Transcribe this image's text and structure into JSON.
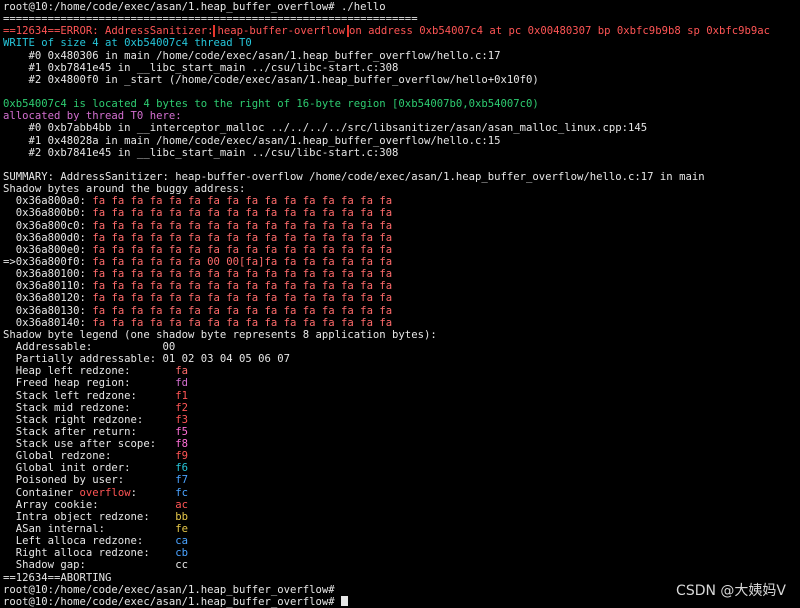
{
  "term": {
    "cmd": "root@10:/home/code/exec/asan/1.heap_buffer_overflow# ./hello",
    "sep": "=================================================================",
    "err_prefix": "==12634==ERROR: AddressSanitizer:",
    "err_kind": "heap-buffer-overflow",
    "err_rest": "on address 0xb54007c4 at pc 0x00480307 bp 0xbfc9b9b8 sp 0xbfc9b9ac",
    "write": "WRITE of size 4 at 0xb54007c4 thread T0",
    "f0": "    #0 0x480306 in main /home/code/exec/asan/1.heap_buffer_overflow/hello.c:17",
    "f1": "    #1 0xb7841e45 in __libc_start_main ../csu/libc-start.c:308",
    "f2": "    #2 0x4800f0 in _start (/home/code/exec/asan/1.heap_buffer_overflow/hello+0x10f0)",
    "located": "0xb54007c4 is located 4 bytes to the right of 16-byte region [0xb54007b0,0xb54007c0)",
    "alloc": "allocated by thread T0 here:",
    "a0": "    #0 0xb7abb4bb in __interceptor_malloc ../../../../src/libsanitizer/asan/asan_malloc_linux.cpp:145",
    "a1": "    #1 0x48028a in main /home/code/exec/asan/1.heap_buffer_overflow/hello.c:15",
    "a2": "    #2 0xb7841e45 in __libc_start_main ../csu/libc-start.c:308",
    "summary": "SUMMARY: AddressSanitizer: heap-buffer-overflow /home/code/exec/asan/1.heap_buffer_overflow/hello.c:17 in main",
    "shadow_hdr": "Shadow bytes around the buggy address:",
    "sh": [
      {
        "addr": "  0x36a800a0:",
        "bytes": "fa fa fa fa fa fa fa fa fa fa fa fa fa fa fa fa"
      },
      {
        "addr": "  0x36a800b0:",
        "bytes": "fa fa fa fa fa fa fa fa fa fa fa fa fa fa fa fa"
      },
      {
        "addr": "  0x36a800c0:",
        "bytes": "fa fa fa fa fa fa fa fa fa fa fa fa fa fa fa fa"
      },
      {
        "addr": "  0x36a800d0:",
        "bytes": "fa fa fa fa fa fa fa fa fa fa fa fa fa fa fa fa"
      },
      {
        "addr": "  0x36a800e0:",
        "bytes": "fa fa fa fa fa fa fa fa fa fa fa fa fa fa fa fa"
      },
      {
        "addr": "=>0x36a800f0:",
        "bytes": "fa fa fa fa fa fa 00 00[fa]fa fa fa fa fa fa fa"
      },
      {
        "addr": "  0x36a80100:",
        "bytes": "fa fa fa fa fa fa fa fa fa fa fa fa fa fa fa fa"
      },
      {
        "addr": "  0x36a80110:",
        "bytes": "fa fa fa fa fa fa fa fa fa fa fa fa fa fa fa fa"
      },
      {
        "addr": "  0x36a80120:",
        "bytes": "fa fa fa fa fa fa fa fa fa fa fa fa fa fa fa fa"
      },
      {
        "addr": "  0x36a80130:",
        "bytes": "fa fa fa fa fa fa fa fa fa fa fa fa fa fa fa fa"
      },
      {
        "addr": "  0x36a80140:",
        "bytes": "fa fa fa fa fa fa fa fa fa fa fa fa fa fa fa fa"
      }
    ],
    "legend_hdr": "Shadow byte legend (one shadow byte represents 8 application bytes):",
    "legend": [
      {
        "label": "  Addressable:           ",
        "val": "00",
        "cls": "w"
      },
      {
        "label": "  Partially addressable: ",
        "val": "01 02 03 04 05 06 07",
        "cls": "w"
      },
      {
        "label": "  Heap left redzone:       ",
        "val": "fa",
        "cls": "fa"
      },
      {
        "label": "  Freed heap region:       ",
        "val": "fd",
        "cls": "m"
      },
      {
        "label": "  Stack left redzone:      ",
        "val": "f1",
        "cls": "r"
      },
      {
        "label": "  Stack mid redzone:       ",
        "val": "f2",
        "cls": "r"
      },
      {
        "label": "  Stack right redzone:     ",
        "val": "f3",
        "cls": "r"
      },
      {
        "label": "  Stack after return:      ",
        "val": "f5",
        "cls": "p"
      },
      {
        "label": "  Stack use after scope:   ",
        "val": "f8",
        "cls": "p"
      },
      {
        "label": "  Global redzone:          ",
        "val": "f9",
        "cls": "r"
      },
      {
        "label": "  Global init order:       ",
        "val": "f6",
        "cls": "c"
      },
      {
        "label": "  Poisoned by user:        ",
        "val": "f7",
        "cls": "b"
      },
      {
        "label": "  Container ",
        "mid": "overflow",
        "label2": ":      ",
        "val": "fc",
        "cls": "b"
      },
      {
        "label": "  Array cookie:            ",
        "val": "ac",
        "cls": "r"
      },
      {
        "label": "  Intra object redzone:    ",
        "val": "bb",
        "cls": "y"
      },
      {
        "label": "  ASan internal:           ",
        "val": "fe",
        "cls": "y"
      },
      {
        "label": "  Left alloca redzone:     ",
        "val": "ca",
        "cls": "b"
      },
      {
        "label": "  Right alloca redzone:    ",
        "val": "cb",
        "cls": "b"
      },
      {
        "label": "  Shadow gap:              ",
        "val": "cc",
        "cls": "w"
      }
    ],
    "abort": "==12634==ABORTING",
    "prompt2": "root@10:/home/code/exec/asan/1.heap_buffer_overflow#",
    "prompt3": "root@10:/home/code/exec/asan/1.heap_buffer_overflow#"
  },
  "watermark": "CSDN @大姨妈V"
}
